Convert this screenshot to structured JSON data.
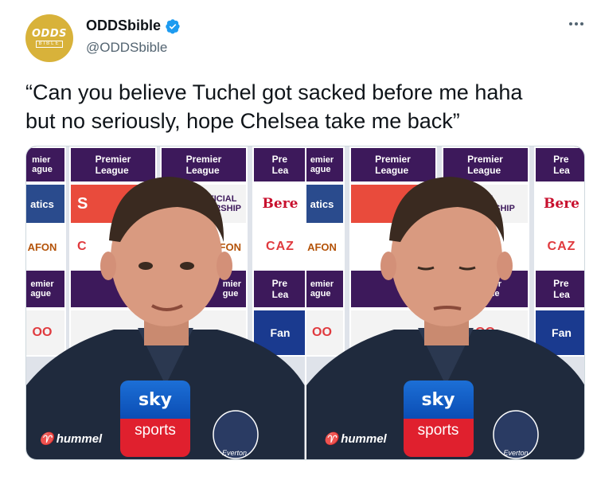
{
  "account": {
    "avatar_top": "ODDS",
    "avatar_bottom": "BIBLE",
    "display_name": "ODDSbible",
    "handle": "@ODDSbible",
    "verified": true
  },
  "icons": {
    "verified": "verified-badge-icon",
    "more": "more-options-icon"
  },
  "tweet": {
    "text": "“Can you believe Tuchel got sacked before me haha\nbut no seriously, hope Chelsea take me back”"
  },
  "media": {
    "frames": [
      {
        "boards_row1": [
          "mier\nague",
          "Premier\nLeague",
          "Premier\nLeague",
          "Pre\nLea"
        ],
        "boards_row2": [
          "atics",
          "S",
          "FICIAL\nERSHIP",
          "Bere"
        ],
        "boards_row3": [
          "AFON",
          "C",
          "FON",
          "CAZ"
        ],
        "boards_row4": [
          "emier\nague",
          "",
          "mier\ngue",
          "Pre\nLea"
        ],
        "boards_row5": [
          "OO",
          "",
          "",
          "Fan"
        ],
        "mic_top": "sky",
        "mic_bottom": "sports",
        "kit_brand": "hummel",
        "crest_text": "Everton"
      },
      {
        "boards_row1": [
          "emier\nague",
          "Premier\nLeague",
          "Premier\nLeague",
          "Pre\nLea"
        ],
        "boards_row2": [
          "atics",
          "",
          "OFFICIAL\nMEMBERSHIP",
          "Bere"
        ],
        "boards_row3": [
          "AFON",
          "",
          "AFON",
          "CAZ"
        ],
        "boards_row4": [
          "emier\nague",
          "",
          "Premier\nLeague",
          "Pre\nLea"
        ],
        "boards_row5": [
          "OO",
          "",
          "OO",
          "Fan"
        ],
        "mic_top": "sky",
        "mic_bottom": "sports",
        "kit_brand": "hummel",
        "crest_text": "Everton"
      }
    ]
  },
  "colors": {
    "brand_gold": "#d8b23a",
    "verified_blue": "#1d9bf0",
    "premier_purple": "#3d195b",
    "sky_blue": "#0b4db4",
    "sky_red": "#e0202e"
  }
}
